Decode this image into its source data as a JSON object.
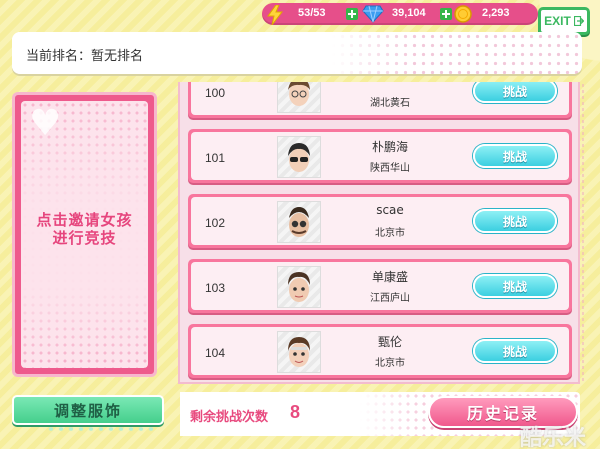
{
  "resources": {
    "energy": "53/53",
    "diamonds": "39,104",
    "coins": "2,293"
  },
  "exit_label": "EXIT",
  "rank": {
    "label": "当前排名：暂无排名"
  },
  "invite": {
    "line1": "点击邀请女孩",
    "line2": "进行竞技"
  },
  "adjust_button": "调整服饰",
  "challenge_label": "挑战",
  "rows": [
    {
      "rank": "100",
      "name": "",
      "location": "湖北黄石"
    },
    {
      "rank": "101",
      "name": "朴鹏海",
      "location": "陕西华山"
    },
    {
      "rank": "102",
      "name": "scae",
      "location": "北京市"
    },
    {
      "rank": "103",
      "name": "单康盛",
      "location": "江西庐山"
    },
    {
      "rank": "104",
      "name": "甄伦",
      "location": "北京市"
    }
  ],
  "remaining": {
    "label": "剩余挑战次数",
    "count": "8"
  },
  "history_button": "历史记录",
  "watermark": "酷乐米",
  "colors": {
    "accent_pink": "#f8769d",
    "challenge_cyan": "#3ccfe0",
    "adjust_green": "#45cf8c",
    "background_yellow": "#f7f0a6"
  }
}
